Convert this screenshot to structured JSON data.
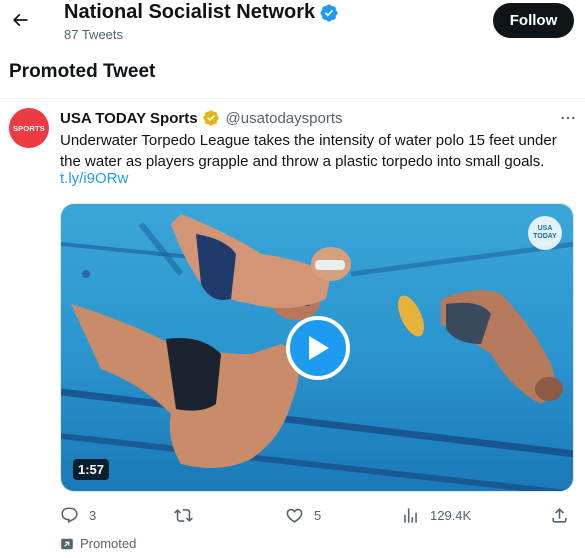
{
  "header": {
    "back_icon": "arrow-left-icon",
    "profile_name": "National Socialist Network",
    "verified_color": "#1d9bf0",
    "tweet_count": "87 Tweets",
    "follow_label": "Follow"
  },
  "section_title": "Promoted Tweet",
  "tweet": {
    "avatar_text": "SPORTS",
    "avatar_color": "#ee3a43",
    "author_name": "USA TODAY Sports",
    "verified_badge": "gold-verified-icon",
    "author_handle": "@usatodaysports",
    "text": "Underwater Torpedo League takes the intensity of water polo 15 feet under the water as players grapple and throw a plastic torpedo into small goals.",
    "link": "t.ly/i9ORw",
    "media": {
      "duration": "1:57",
      "watermark_line1": "USA",
      "watermark_line2": "TODAY",
      "play_icon": "play-icon"
    },
    "actions": {
      "replies": "3",
      "retweets": "",
      "likes": "5",
      "views": "129.4K"
    },
    "promoted_label": "Promoted"
  },
  "colors": {
    "accent": "#1d9bf0",
    "text_primary": "#0f1419",
    "text_secondary": "#536471",
    "gold_badge": "#e2b719"
  }
}
